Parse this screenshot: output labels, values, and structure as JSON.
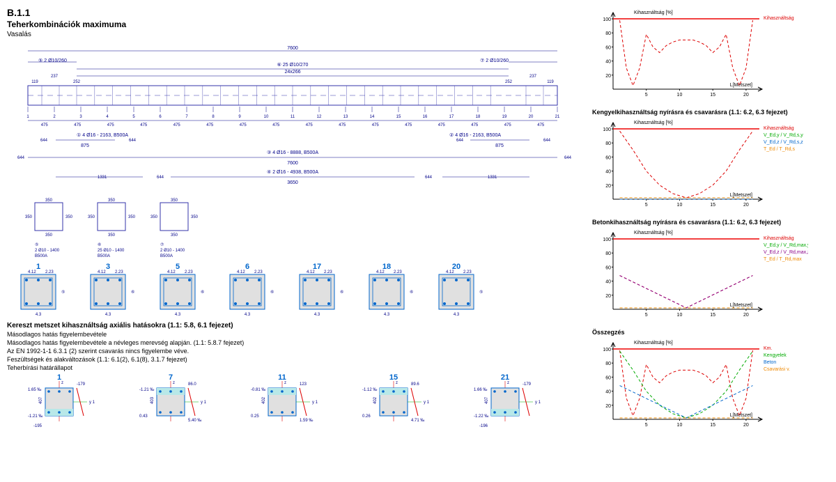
{
  "header": {
    "section_number": "B.1.1",
    "title": "Teherkombinációk maximuma",
    "subtitle": "Vasalás"
  },
  "elevation": {
    "total_length": "7600",
    "top_stirrup_left": "2 Ø10/260",
    "top_stirrup_left_mark": "5",
    "top_stirrup_right": "2 Ø10/260",
    "top_stirrup_right_mark": "7",
    "mid_stirrup": "25 Ø10/270",
    "mid_stirrup_mark": "6",
    "mid_seg_count": "24x266",
    "edge_dims": [
      "119",
      "237",
      "252"
    ],
    "section_marks": [
      "1",
      "2",
      "3",
      "4",
      "5",
      "6",
      "7",
      "8",
      "9",
      "10",
      "11",
      "12",
      "13",
      "14",
      "15",
      "16",
      "17",
      "18",
      "19",
      "20",
      "21"
    ],
    "bay_dims": [
      "475",
      "475",
      "475",
      "475",
      "475",
      "475",
      "475",
      "475",
      "475",
      "475",
      "475",
      "475",
      "475",
      "475",
      "475",
      "475"
    ],
    "rebar_rows": {
      "bar1": {
        "mark": "1",
        "spec": "4 Ø16 - 2163, B500A",
        "len": "875",
        "off": "644"
      },
      "bar2": {
        "mark": "2",
        "spec": "4 Ø16 - 2163, B500A",
        "len": "875",
        "off": "644"
      },
      "bar3": {
        "mark": "3",
        "spec": "4 Ø16 - 8888, B500A",
        "len": "7600",
        "off": "644"
      },
      "bar4": {
        "mark": "4",
        "spec": "2 Ø16 - 4938, B500A",
        "len": "3650",
        "off1": "644",
        "off2": "1331"
      }
    }
  },
  "cross_sections": {
    "dims": [
      "350",
      "350",
      "350",
      "350"
    ],
    "items": [
      {
        "mark": "5",
        "spec": "2 Ø10 - 1400",
        "grade": "B500A"
      },
      {
        "mark": "6",
        "spec": "25 Ø10 - 1400",
        "grade": "B500A"
      },
      {
        "mark": "7",
        "spec": "2 Ø10 - 1400",
        "grade": "B500A"
      }
    ],
    "detail_sections": [
      "1",
      "3",
      "5",
      "6",
      "17",
      "18",
      "20"
    ],
    "detail_labels": {
      "top_left": "4.12",
      "top_right": "4.12",
      "bot": "2.23",
      "side": "6",
      "stirrup_mark": "5"
    }
  },
  "text_block": {
    "heading": "Kereszt metszet kihasználtság axiális hatásokra (1.1: 5.8, 6.1 fejezet)",
    "lines": [
      "Másodlagos hatás figyelembevétele",
      "Másodlagos hatás figyelembevétele a névleges merevség alapján. (1.1: 5.8.7 fejezet)",
      "Az EN 1992-1-1 6.3.1 (2) szerint csavarás nincs figyelembe véve.",
      "Feszültségek és alakváltozások (1.1: 6.1(2), 6.1(8), 3.1.7 fejezet)",
      "Teherbírási határállapot"
    ]
  },
  "stress_sections": [
    {
      "num": "1",
      "eps_top": "1.65 ‰",
      "eps_bot": "-1.21 ‰",
      "M": "-179",
      "M2": "-195",
      "y": "y 1",
      "h": "407"
    },
    {
      "num": "7",
      "eps_top": "-1.21 ‰",
      "eps_bot": "0.43",
      "right": "5.40 ‰",
      "M": "86.0",
      "h": "403"
    },
    {
      "num": "11",
      "eps_top": "-0.81 ‰",
      "eps_bot": "0.25",
      "right": "1.59 ‰",
      "M": "123",
      "h": "402"
    },
    {
      "num": "15",
      "eps_top": "-1.12 ‰",
      "eps_bot": "0.26",
      "right": "4.71 ‰",
      "M": "89.6",
      "h": "402"
    },
    {
      "num": "21",
      "eps_top": "1.66 ‰",
      "eps_bot": "-1.22 ‰",
      "M": "-179",
      "M2": "-196",
      "h": "407"
    }
  ],
  "chart_data": [
    {
      "type": "line",
      "title": "",
      "ylabel": "Kihasználtság [%]",
      "xlabel": "L[Metszet]",
      "xlim": [
        0,
        22
      ],
      "ylim": [
        0,
        105
      ],
      "xticks": [
        5,
        10,
        15,
        20
      ],
      "yticks": [
        20,
        40,
        60,
        80,
        100
      ],
      "series": [
        {
          "name": "Kihasználtság",
          "color": "red-dash",
          "x": [
            1,
            2,
            3,
            4,
            5,
            6,
            7,
            8,
            9,
            10,
            11,
            12,
            13,
            14,
            15,
            16,
            17,
            18,
            19,
            20,
            21
          ],
          "y": [
            98,
            30,
            5,
            30,
            78,
            60,
            52,
            62,
            67,
            70,
            70,
            70,
            67,
            62,
            52,
            60,
            78,
            30,
            5,
            30,
            98
          ]
        }
      ],
      "limit": 100
    },
    {
      "type": "line",
      "title": "Kengyelkihasználtság nyírásra és csavarásra (1.1: 6.2, 6.3 fejezet)",
      "ylabel": "Kihasználtság [%]",
      "xlabel": "L[Metszet]",
      "xlim": [
        0,
        22
      ],
      "ylim": [
        0,
        105
      ],
      "xticks": [
        5,
        10,
        15,
        20
      ],
      "yticks": [
        20,
        40,
        60,
        80,
        100
      ],
      "series": [
        {
          "name": "Kihasználtság",
          "color": "red-dash",
          "x": [
            1,
            3,
            5,
            7,
            9,
            11,
            13,
            15,
            17,
            19,
            21
          ],
          "y": [
            97,
            70,
            40,
            20,
            8,
            2,
            8,
            20,
            40,
            70,
            97
          ]
        },
        {
          "name": "V_Ed,y / V_Rd,s,y",
          "color": "green-dash",
          "x": [
            1,
            21
          ],
          "y": [
            2,
            2
          ]
        },
        {
          "name": "V_Ed,z / V_Rd,s,z",
          "color": "blue-dash",
          "x": [
            1,
            21
          ],
          "y": [
            0,
            0
          ]
        },
        {
          "name": "T_Ed / T_Rd,s",
          "color": "orange-dash",
          "x": [
            1,
            21
          ],
          "y": [
            2,
            2
          ]
        }
      ],
      "limit": 100
    },
    {
      "type": "line",
      "title": "Betonkihasználtság nyírásra és csavarásra (1.1: 6.2, 6.3 fejezet)",
      "ylabel": "Kihasználtság [%]",
      "xlabel": "L[Metszet]",
      "xlim": [
        0,
        22
      ],
      "ylim": [
        0,
        105
      ],
      "xticks": [
        5,
        10,
        15,
        20
      ],
      "yticks": [
        20,
        40,
        60,
        80,
        100
      ],
      "series": [
        {
          "name": "Kihasználtság",
          "color": "red-dash",
          "x": [
            1,
            11,
            21
          ],
          "y": [
            48,
            2,
            48
          ]
        },
        {
          "name": "V_Ed,y / V_Rd,max,y",
          "color": "green-dash",
          "x": [
            1,
            21
          ],
          "y": [
            2,
            2
          ]
        },
        {
          "name": "V_Ed,z / V_Rd,max,z",
          "color": "purple-dash",
          "x": [
            1,
            11,
            21
          ],
          "y": [
            48,
            2,
            48
          ]
        },
        {
          "name": "T_Ed / T_Rd,max",
          "color": "orange-dash",
          "x": [
            1,
            21
          ],
          "y": [
            2,
            2
          ]
        }
      ],
      "limit": 100
    },
    {
      "type": "line",
      "title": "Összegzés",
      "ylabel": "Kihasználtság [%]",
      "xlabel": "L[Metszet]",
      "xlim": [
        0,
        22
      ],
      "ylim": [
        0,
        105
      ],
      "xticks": [
        5,
        10,
        15,
        20
      ],
      "yticks": [
        20,
        40,
        60,
        80,
        100
      ],
      "series": [
        {
          "name": "Km.",
          "color": "red-dash",
          "x": [
            1,
            2,
            3,
            4,
            5,
            6,
            7,
            8,
            9,
            10,
            11,
            12,
            13,
            14,
            15,
            16,
            17,
            18,
            19,
            20,
            21
          ],
          "y": [
            98,
            30,
            5,
            30,
            78,
            60,
            52,
            62,
            67,
            70,
            70,
            70,
            67,
            62,
            52,
            60,
            78,
            30,
            5,
            30,
            98
          ]
        },
        {
          "name": "Kengyelek",
          "color": "green-dash",
          "x": [
            1,
            3,
            5,
            7,
            9,
            11,
            13,
            15,
            17,
            19,
            21
          ],
          "y": [
            97,
            70,
            40,
            20,
            8,
            2,
            8,
            20,
            40,
            70,
            97
          ]
        },
        {
          "name": "Beton",
          "color": "blue-dash",
          "x": [
            1,
            11,
            21
          ],
          "y": [
            48,
            2,
            48
          ]
        },
        {
          "name": "Csavarási v.",
          "color": "orange-dash",
          "x": [
            1,
            21
          ],
          "y": [
            2,
            2
          ]
        }
      ],
      "limit": 100
    }
  ]
}
